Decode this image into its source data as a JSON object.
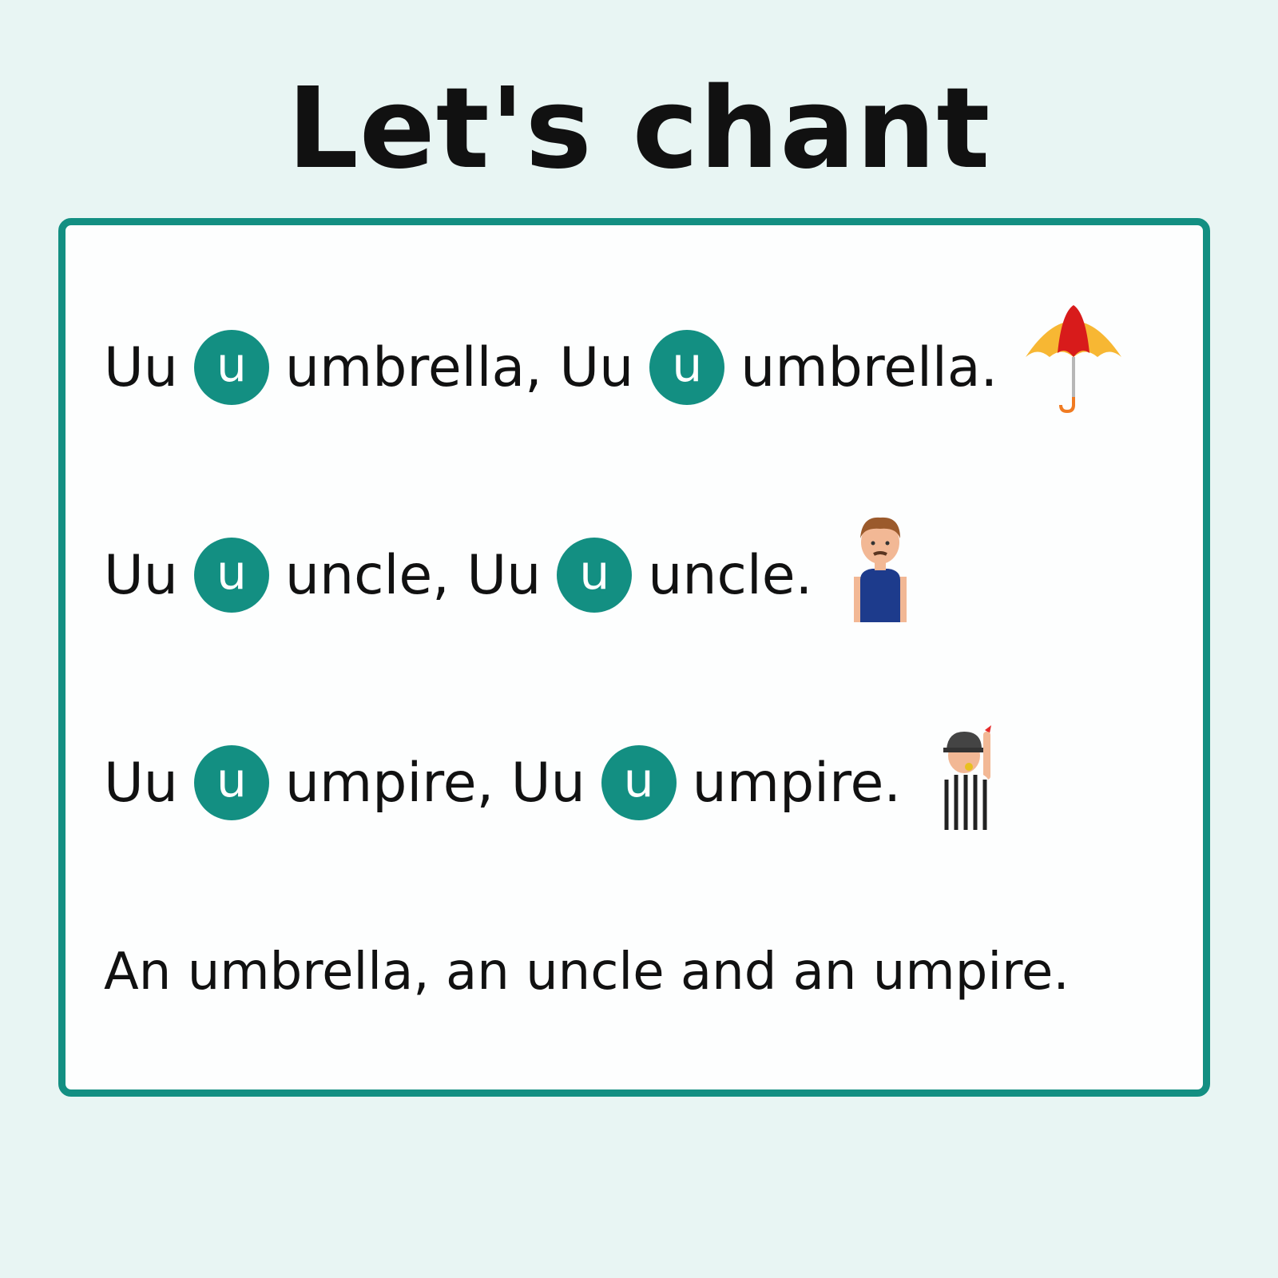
{
  "title": "Let's chant",
  "lines": [
    {
      "a": "Uu",
      "circle": "u",
      "b": "umbrella, Uu",
      "circle2": "u",
      "c": "umbrella.",
      "icon": "umbrella-icon"
    },
    {
      "a": "Uu",
      "circle": "u",
      "b": "uncle, Uu",
      "circle2": "u",
      "c": "uncle.",
      "icon": "uncle-icon"
    },
    {
      "a": "Uu",
      "circle": "u",
      "b": "umpire, Uu",
      "circle2": "u",
      "c": "umpire.",
      "icon": "umpire-icon"
    }
  ],
  "summary": "An umbrella, an uncle and an umpire.",
  "colors": {
    "accent": "#138f82",
    "background": "#e8f5f3",
    "card": "#fdfefe"
  }
}
